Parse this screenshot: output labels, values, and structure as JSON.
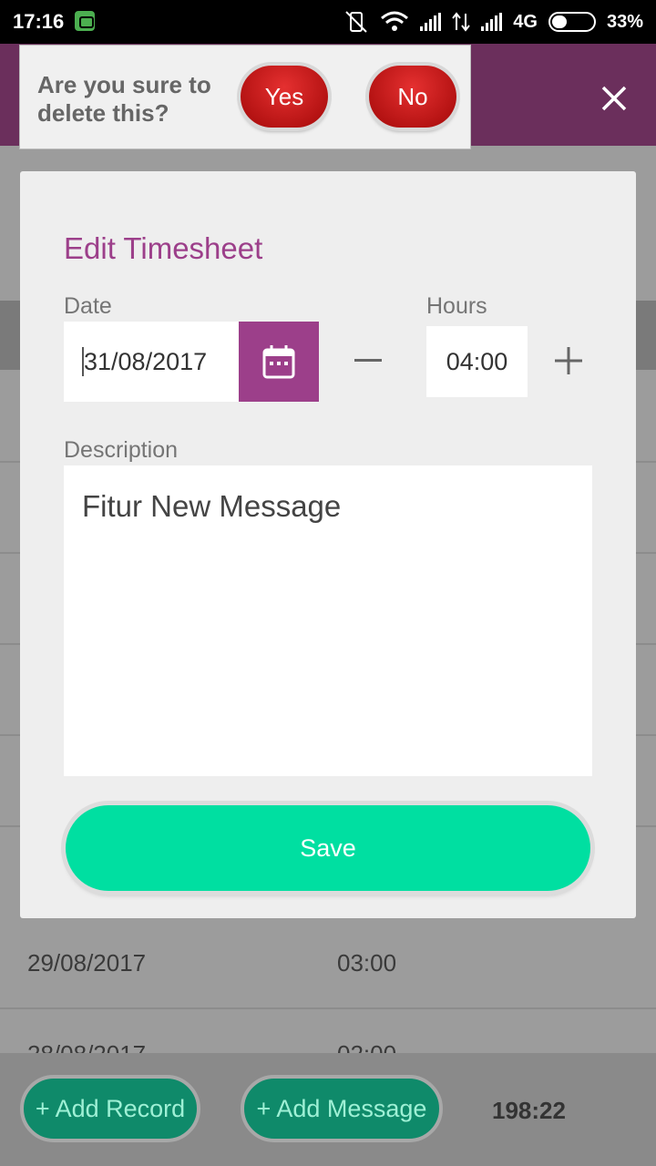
{
  "status_bar": {
    "time": "17:16",
    "network": "4G",
    "battery": "33%"
  },
  "confirm": {
    "message": "Are you sure to delete this?",
    "yes_label": "Yes",
    "no_label": "No"
  },
  "dialog": {
    "title": "Edit Timesheet",
    "date_label": "Date",
    "date_value": "31/08/2017",
    "hours_label": "Hours",
    "hours_value": "04:00",
    "minus_label": "−",
    "plus_label": "+",
    "description_label": "Description",
    "description_value": "Fitur New Message",
    "save_label": "Save"
  },
  "records": [
    {
      "date": "29/08/2017",
      "hours": "03:00"
    },
    {
      "date": "28/08/2017",
      "hours": "02:00"
    }
  ],
  "bottom": {
    "add_record_label": "+ Add Record",
    "add_message_label": "+ Add Message",
    "total_hours": "198:22"
  },
  "colors": {
    "accent": "#9c3f8a",
    "app_bar": "#6b2f5c",
    "save": "#00dfa1",
    "danger": "#c41010"
  }
}
